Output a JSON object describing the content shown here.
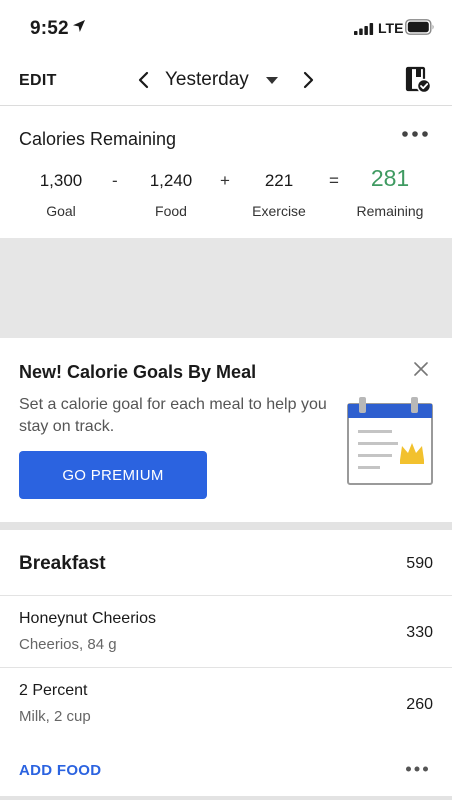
{
  "status_bar": {
    "time": "9:52",
    "network": "LTE",
    "icons": [
      "location-arrow-icon",
      "cell-signal-icon",
      "battery-icon"
    ]
  },
  "nav": {
    "edit_label": "EDIT",
    "date_label": "Yesterday",
    "icons": [
      "chevron-left-icon",
      "caret-down-icon",
      "chevron-right-icon",
      "diary-complete-icon"
    ]
  },
  "calories": {
    "title": "Calories Remaining",
    "goal_value": "1,300",
    "goal_label": "Goal",
    "minus_op": "-",
    "food_value": "1,240",
    "food_label": "Food",
    "plus_op": "+",
    "exercise_value": "221",
    "exercise_label": "Exercise",
    "equals_op": "=",
    "remaining_value": "281",
    "remaining_label": "Remaining",
    "remaining_color": "#3f9a61"
  },
  "promo": {
    "title": "New! Calorie Goals By Meal",
    "body": "Set a calorie goal for each meal to help you stay on track.",
    "button_label": "GO PREMIUM",
    "button_color": "#2b63e0",
    "icons": [
      "close-icon",
      "calendar-crown-illustration"
    ]
  },
  "meal": {
    "name": "Breakfast",
    "calories": "590",
    "foods": [
      {
        "name": "Honeynut Cheerios",
        "detail": "Cheerios, 84 g",
        "calories": "330"
      },
      {
        "name": "2 Percent",
        "detail": "Milk, 2 cup",
        "calories": "260"
      }
    ],
    "add_label": "ADD FOOD",
    "accent_color": "#2b63e0"
  }
}
